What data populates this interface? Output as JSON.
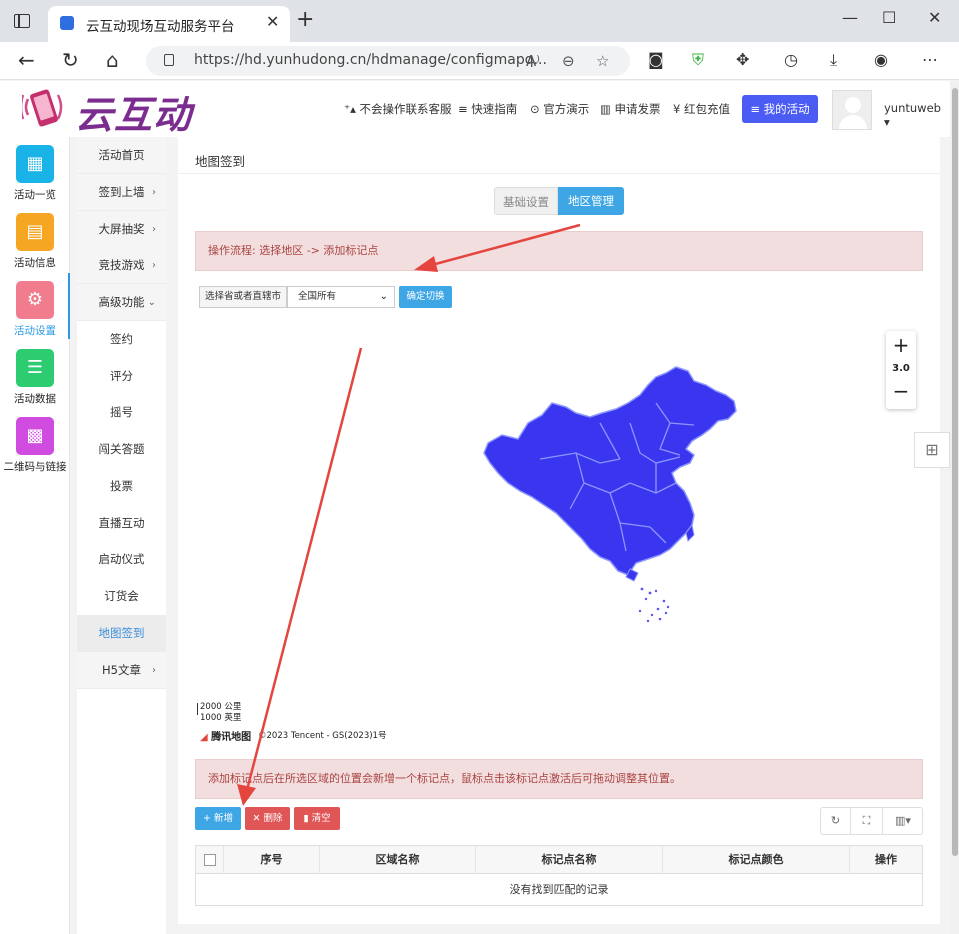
{
  "browser": {
    "tab_title": "云互动现场互动服务平台",
    "url": "https://hd.yunhudong.cn/hdmanage/configmapq...",
    "tab_close": "✕",
    "new_tab": "+",
    "minimize": "—",
    "maximize": "☐",
    "close": "✕"
  },
  "header": {
    "logo_text": "云互动",
    "nav": [
      {
        "label": "不会操作联系客服",
        "icon": "person-add-icon"
      },
      {
        "label": "快速指南",
        "icon": "list-icon"
      },
      {
        "label": "官方演示",
        "icon": "play-icon"
      },
      {
        "label": "申请发票",
        "icon": "barcode-icon"
      },
      {
        "label": "红包充值",
        "icon": "yen-icon"
      }
    ],
    "my_activity": "我的活动",
    "username": "yuntuweb"
  },
  "iconbar": [
    {
      "label": "活动一览",
      "color": "#1ab3e8",
      "icon": "grid-icon"
    },
    {
      "label": "活动信息",
      "color": "#f5a623",
      "icon": "document-icon"
    },
    {
      "label": "活动设置",
      "color": "#f07c8e",
      "icon": "gear-icon"
    },
    {
      "label": "活动数据",
      "color": "#2ecc71",
      "icon": "database-icon"
    },
    {
      "label": "二维码与链接",
      "color": "#d04be0",
      "icon": "qrcode-icon"
    }
  ],
  "menu": [
    "活动首页",
    "签到上墙",
    "大屏抽奖",
    "竞技游戏",
    "高级功能",
    "签约",
    "评分",
    "摇号",
    "闯关答题",
    "投票",
    "直播互动",
    "启动仪式",
    "订货会",
    "地图签到",
    "H5文章"
  ],
  "main": {
    "page_title": "地图签到",
    "seg_basic": "基础设置",
    "seg_region": "地区管理",
    "alert_top": "操作流程: 选择地区 -> 添加标记点",
    "select_label": "选择省或者直辖市",
    "select_value": "全国所有",
    "confirm_btn": "确定切换",
    "zoom_level": "3.0",
    "scale_km": "2000 公里",
    "scale_mi": "1000 英里",
    "map_brand": "腾讯地图",
    "map_copyright": "©2023 Tencent - GS(2023)1号",
    "alert_bottom": "添加标记点后在所选区域的位置会新增一个标记点，鼠标点击该标记点激活后可拖动调整其位置。",
    "btn_add": "+ 新增",
    "btn_delete": "✕ 删除",
    "btn_clear": "清空",
    "table_headers": [
      "序号",
      "区域名称",
      "标记点名称",
      "标记点颜色",
      "操作"
    ],
    "table_empty": "没有找到匹配的记录"
  },
  "colors": {
    "primary": "#3fa6e6",
    "danger": "#e05555",
    "map_fill": "#3a36f0",
    "annotation_arrow": "#e5453f"
  }
}
